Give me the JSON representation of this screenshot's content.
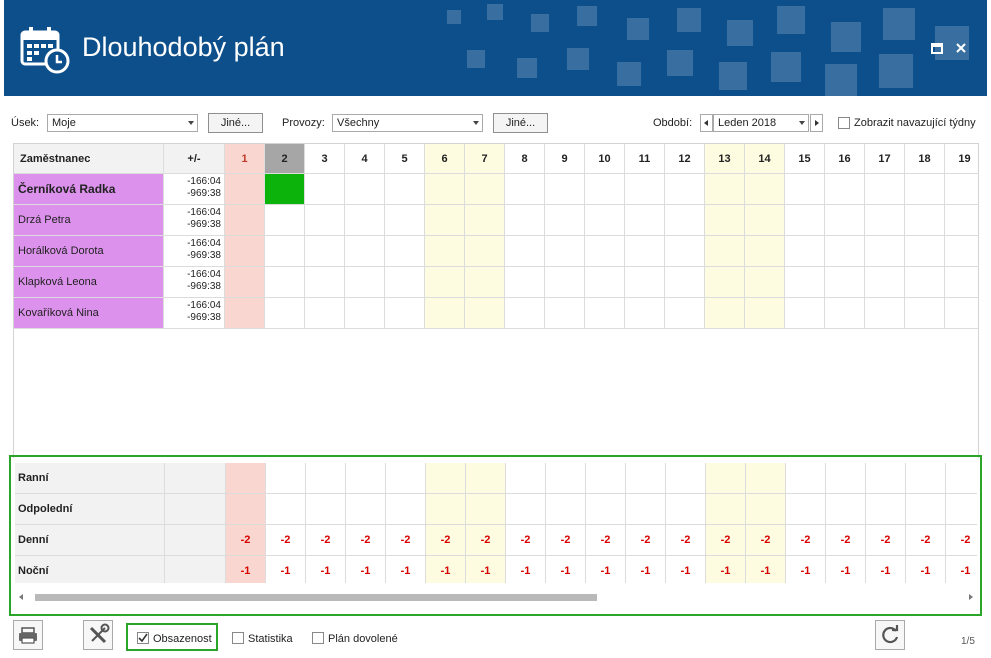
{
  "window": {
    "title": "Dlouhodobý plán"
  },
  "filters": {
    "usek_label": "Úsek:",
    "usek_value": "Moje",
    "usek_other": "Jiné...",
    "provozy_label": "Provozy:",
    "provozy_value": "Všechny",
    "provozy_other": "Jiné...",
    "obdobi_label": "Období:",
    "obdobi_value": "Leden 2018",
    "show_weeks_label": "Zobrazit navazující týdny",
    "show_weeks_checked": false
  },
  "grid": {
    "col_employee": "Zaměstnanec",
    "col_diff": "+/-",
    "days": [
      "1",
      "2",
      "3",
      "4",
      "5",
      "6",
      "7",
      "8",
      "9",
      "10",
      "11",
      "12",
      "13",
      "14",
      "15",
      "16",
      "17",
      "18",
      "19"
    ],
    "highlight_day": "1",
    "selected_day": "2",
    "weekend_days": [
      "6",
      "7",
      "13",
      "14"
    ],
    "employees": [
      {
        "name": "Černíková Radka",
        "bold": true,
        "diff1": "-166:04",
        "diff2": "-969:38",
        "filled_day": "2"
      },
      {
        "name": "Drzá Petra",
        "bold": false,
        "diff1": "-166:04",
        "diff2": "-969:38"
      },
      {
        "name": "Horálková Dorota",
        "bold": false,
        "diff1": "-166:04",
        "diff2": "-969:38"
      },
      {
        "name": "Klapková Leona",
        "bold": false,
        "diff1": "-166:04",
        "diff2": "-969:38"
      },
      {
        "name": "Kovaříková Nina",
        "bold": false,
        "diff1": "-166:04",
        "diff2": "-969:38"
      }
    ]
  },
  "summary": {
    "rows": [
      {
        "label": "Ranní",
        "value": ""
      },
      {
        "label": "Odpolední",
        "value": ""
      },
      {
        "label": "Denní",
        "value": "-2"
      },
      {
        "label": "Noční",
        "value": "-1"
      }
    ]
  },
  "footer": {
    "obsazenost_label": "Obsazenost",
    "obsazenost_checked": true,
    "statistika_label": "Statistika",
    "plan_dovolene_label": "Plán dovolené",
    "page": "1/5"
  },
  "colors": {
    "header_bg": "#0d4f8b",
    "employee_bg": "#dc91ec",
    "day1_bg": "#f9d6cf",
    "weekend_bg": "#fdfbe0",
    "selected_header": "#a6a6a6",
    "filled_cell": "#0bb30b",
    "summary_border": "#2aa52a",
    "negative": "#d90000"
  }
}
